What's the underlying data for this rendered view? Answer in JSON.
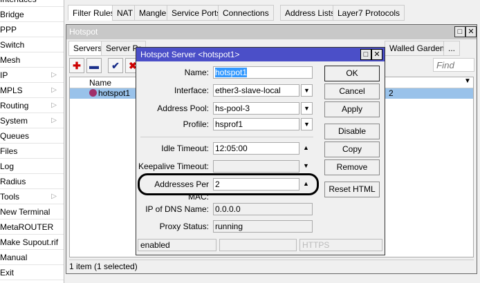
{
  "sidebar": {
    "items": [
      {
        "label": "Interfaces",
        "arrow": false
      },
      {
        "label": "Bridge",
        "arrow": false
      },
      {
        "label": "PPP",
        "arrow": false
      },
      {
        "label": "Switch",
        "arrow": false
      },
      {
        "label": "Mesh",
        "arrow": false
      },
      {
        "label": "IP",
        "arrow": true
      },
      {
        "label": "MPLS",
        "arrow": true
      },
      {
        "label": "Routing",
        "arrow": true
      },
      {
        "label": "System",
        "arrow": true
      },
      {
        "label": "Queues",
        "arrow": false
      },
      {
        "label": "Files",
        "arrow": false
      },
      {
        "label": "Log",
        "arrow": false
      },
      {
        "label": "Radius",
        "arrow": false
      },
      {
        "label": "Tools",
        "arrow": true
      },
      {
        "label": "New Terminal",
        "arrow": false
      },
      {
        "label": "MetaROUTER",
        "arrow": false
      },
      {
        "label": "Make Supout.rif",
        "arrow": false
      },
      {
        "label": "Manual",
        "arrow": false
      },
      {
        "label": "Exit",
        "arrow": false
      }
    ]
  },
  "firewall_tabs": [
    "Filter Rules",
    "NAT",
    "Mangle",
    "Service Ports",
    "Connections",
    "Address Lists",
    "Layer7 Protocols"
  ],
  "hotspot": {
    "title": "Hotspot",
    "tabs": [
      "Servers",
      "Server Pr",
      "Walled Garden",
      "..."
    ],
    "find_placeholder": "Find",
    "column_name": "Name",
    "row_name": "hotspot1",
    "row_partial": "2",
    "status": "1 item (1 selected)"
  },
  "dialog": {
    "title": "Hotspot Server <hotspot1>",
    "fields": {
      "name": {
        "label": "Name:",
        "value": "hotspot1"
      },
      "interface": {
        "label": "Interface:",
        "value": "ether3-slave-local"
      },
      "address_pool": {
        "label": "Address Pool:",
        "value": "hs-pool-3"
      },
      "profile": {
        "label": "Profile:",
        "value": "hsprof1"
      },
      "idle_timeout": {
        "label": "Idle Timeout:",
        "value": "12:05:00"
      },
      "keepalive_timeout": {
        "label": "Keepalive Timeout:",
        "value": ""
      },
      "addresses_per_mac": {
        "label": "Addresses Per MAC:",
        "value": "2"
      },
      "ip_dns": {
        "label": "IP of DNS Name:",
        "value": "0.0.0.0"
      },
      "proxy_status": {
        "label": "Proxy Status:",
        "value": "running"
      }
    },
    "buttons": {
      "ok": "OK",
      "cancel": "Cancel",
      "apply": "Apply",
      "disable": "Disable",
      "copy": "Copy",
      "remove": "Remove",
      "reset_html": "Reset HTML"
    },
    "status": {
      "state": "enabled",
      "middle": "",
      "https": "HTTPS"
    }
  },
  "colors": {
    "dialog_title": "#4b4fc8",
    "selection": "#99c2ea",
    "highlight": "#3399ff"
  }
}
